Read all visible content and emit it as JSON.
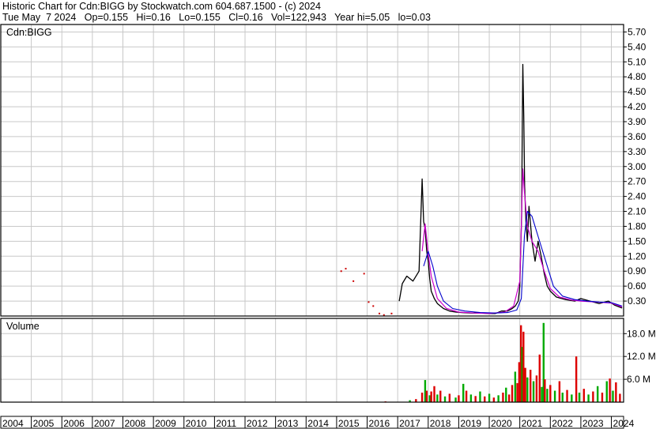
{
  "header": {
    "line1": "Historic Chart for Cdn:BIGG by Stockwatch.com 604.687.1500 - (c) 2024",
    "line2": "Tue May  7 2024   Op=0.155   Hi=0.16   Lo=0.155   Cl=0.16   Vol=122,943   Year hi=5.05   lo=0.03"
  },
  "colors": {
    "background": "#ffffff",
    "grid": "#c8c8c8",
    "price": "#000000",
    "ma_short": "#cc00cc",
    "ma_long": "#0000cc",
    "volume_up": "#00aa00",
    "volume_down": "#dd0000",
    "early_price": "#cc0000"
  },
  "chart_data": [
    {
      "type": "line",
      "panel_label": "Cdn:BIGG",
      "ylim": [
        0,
        5.85
      ],
      "y_ticks": [
        "5.70",
        "5.40",
        "5.10",
        "4.80",
        "4.50",
        "4.20",
        "3.90",
        "3.60",
        "3.30",
        "3.00",
        "2.70",
        "2.40",
        "2.10",
        "1.80",
        "1.50",
        "1.20",
        "0.90",
        "0.60",
        "0.30"
      ],
      "x_ticks": [
        "2004",
        "2005",
        "2006",
        "2007",
        "2008",
        "2009",
        "2010",
        "2011",
        "2012",
        "2013",
        "2014",
        "2015",
        "2016",
        "2017",
        "2018",
        "2019",
        "2020",
        "2021",
        "2022",
        "2023",
        "2024"
      ],
      "grid": true,
      "series": [
        {
          "role": "price",
          "x": [
            2017.05,
            2017.15,
            2017.3,
            2017.5,
            2017.7,
            2017.8,
            2017.85,
            2017.9,
            2017.95,
            2018.0,
            2018.05,
            2018.1,
            2018.2,
            2018.3,
            2018.5,
            2018.7,
            2018.9,
            2019.1,
            2019.4,
            2019.7,
            2020.0,
            2020.2,
            2020.4,
            2020.6,
            2020.75,
            2020.85,
            2020.95,
            2021.0,
            2021.03,
            2021.06,
            2021.08,
            2021.1,
            2021.13,
            2021.16,
            2021.2,
            2021.25,
            2021.3,
            2021.4,
            2021.5,
            2021.6,
            2021.7,
            2021.8,
            2021.9,
            2022.0,
            2022.2,
            2022.5,
            2022.8,
            2023.0,
            2023.3,
            2023.6,
            2023.9,
            2024.1,
            2024.35
          ],
          "values": [
            0.3,
            0.65,
            0.8,
            0.7,
            0.9,
            2.75,
            1.9,
            1.75,
            1.3,
            1.1,
            0.75,
            0.5,
            0.35,
            0.25,
            0.15,
            0.1,
            0.08,
            0.07,
            0.06,
            0.06,
            0.05,
            0.05,
            0.1,
            0.1,
            0.15,
            0.2,
            0.3,
            0.6,
            1.3,
            2.0,
            3.8,
            5.05,
            4.0,
            2.6,
            1.9,
            1.5,
            2.2,
            1.5,
            1.1,
            1.5,
            1.2,
            0.85,
            0.6,
            0.5,
            0.38,
            0.33,
            0.3,
            0.35,
            0.3,
            0.25,
            0.3,
            0.22,
            0.16
          ]
        },
        {
          "role": "moving-average-short",
          "x": [
            2017.8,
            2017.9,
            2018.0,
            2018.1,
            2018.3,
            2018.6,
            2019.0,
            2019.5,
            2020.0,
            2020.5,
            2020.8,
            2021.0,
            2021.05,
            2021.1,
            2021.15,
            2021.25,
            2021.4,
            2021.6,
            2021.8,
            2022.0,
            2022.3,
            2022.7,
            2023.0,
            2023.5,
            2024.0,
            2024.35
          ],
          "values": [
            1.3,
            1.85,
            1.25,
            0.8,
            0.35,
            0.15,
            0.08,
            0.06,
            0.05,
            0.08,
            0.2,
            0.7,
            1.8,
            2.95,
            2.5,
            1.8,
            1.5,
            1.3,
            0.9,
            0.55,
            0.38,
            0.32,
            0.3,
            0.28,
            0.26,
            0.18
          ]
        },
        {
          "role": "moving-average-long",
          "x": [
            2017.85,
            2018.0,
            2018.15,
            2018.3,
            2018.5,
            2018.8,
            2019.2,
            2019.7,
            2020.2,
            2020.6,
            2020.9,
            2021.05,
            2021.15,
            2021.25,
            2021.4,
            2021.6,
            2021.85,
            2022.1,
            2022.4,
            2022.8,
            2023.2,
            2023.6,
            2024.0,
            2024.35
          ],
          "values": [
            1.0,
            1.3,
            1.0,
            0.6,
            0.3,
            0.15,
            0.1,
            0.07,
            0.06,
            0.07,
            0.12,
            0.35,
            1.6,
            2.1,
            2.0,
            1.6,
            1.1,
            0.6,
            0.4,
            0.33,
            0.3,
            0.28,
            0.27,
            0.2
          ]
        },
        {
          "role": "early-sparse-trades",
          "x": [
            2015.15,
            2015.3,
            2015.55,
            2015.9,
            2016.05,
            2016.2,
            2016.4,
            2016.55,
            2016.8
          ],
          "values": [
            0.9,
            0.95,
            0.7,
            0.85,
            0.28,
            0.2,
            0.05,
            0.02,
            0.05
          ]
        }
      ]
    },
    {
      "type": "bar",
      "panel_label": "Volume",
      "ylim": [
        0,
        22
      ],
      "y_ticks": [
        "18.0 M",
        "12.0 M",
        "6.0 M"
      ],
      "bars": [
        {
          "x": 2016.6,
          "v": 0.2,
          "up": false
        },
        {
          "x": 2017.4,
          "v": 0.5,
          "up": true
        },
        {
          "x": 2017.6,
          "v": 0.8,
          "up": false
        },
        {
          "x": 2017.8,
          "v": 2.5,
          "up": false
        },
        {
          "x": 2017.9,
          "v": 5.8,
          "up": true
        },
        {
          "x": 2017.95,
          "v": 3.0,
          "up": false
        },
        {
          "x": 2018.05,
          "v": 1.8,
          "up": true
        },
        {
          "x": 2018.1,
          "v": 2.8,
          "up": false
        },
        {
          "x": 2018.2,
          "v": 4.2,
          "up": false
        },
        {
          "x": 2018.3,
          "v": 2.0,
          "up": true
        },
        {
          "x": 2018.4,
          "v": 3.0,
          "up": false
        },
        {
          "x": 2018.55,
          "v": 1.5,
          "up": true
        },
        {
          "x": 2018.7,
          "v": 2.2,
          "up": false
        },
        {
          "x": 2018.9,
          "v": 1.2,
          "up": true
        },
        {
          "x": 2019.0,
          "v": 1.8,
          "up": false
        },
        {
          "x": 2019.15,
          "v": 4.8,
          "up": true
        },
        {
          "x": 2019.25,
          "v": 3.0,
          "up": false
        },
        {
          "x": 2019.4,
          "v": 2.0,
          "up": true
        },
        {
          "x": 2019.55,
          "v": 1.6,
          "up": false
        },
        {
          "x": 2019.7,
          "v": 2.8,
          "up": true
        },
        {
          "x": 2019.85,
          "v": 1.5,
          "up": false
        },
        {
          "x": 2020.0,
          "v": 2.2,
          "up": true
        },
        {
          "x": 2020.15,
          "v": 1.2,
          "up": false
        },
        {
          "x": 2020.3,
          "v": 1.8,
          "up": true
        },
        {
          "x": 2020.45,
          "v": 2.5,
          "up": false
        },
        {
          "x": 2020.55,
          "v": 3.8,
          "up": true
        },
        {
          "x": 2020.65,
          "v": 2.0,
          "up": false
        },
        {
          "x": 2020.75,
          "v": 4.5,
          "up": false
        },
        {
          "x": 2020.85,
          "v": 8.0,
          "up": true
        },
        {
          "x": 2020.92,
          "v": 5.0,
          "up": false
        },
        {
          "x": 2020.98,
          "v": 10.5,
          "up": false
        },
        {
          "x": 2021.04,
          "v": 20.2,
          "up": false
        },
        {
          "x": 2021.08,
          "v": 14.5,
          "up": true
        },
        {
          "x": 2021.12,
          "v": 18.5,
          "up": false
        },
        {
          "x": 2021.18,
          "v": 9.0,
          "up": false
        },
        {
          "x": 2021.25,
          "v": 6.5,
          "up": true
        },
        {
          "x": 2021.35,
          "v": 8.5,
          "up": false
        },
        {
          "x": 2021.45,
          "v": 5.5,
          "up": true
        },
        {
          "x": 2021.55,
          "v": 7.0,
          "up": false
        },
        {
          "x": 2021.65,
          "v": 12.5,
          "up": false
        },
        {
          "x": 2021.72,
          "v": 4.0,
          "up": true
        },
        {
          "x": 2021.78,
          "v": 20.8,
          "up": true
        },
        {
          "x": 2021.82,
          "v": 6.0,
          "up": false
        },
        {
          "x": 2021.9,
          "v": 3.5,
          "up": true
        },
        {
          "x": 2022.0,
          "v": 4.5,
          "up": false
        },
        {
          "x": 2022.15,
          "v": 3.0,
          "up": true
        },
        {
          "x": 2022.3,
          "v": 5.5,
          "up": false
        },
        {
          "x": 2022.4,
          "v": 2.5,
          "up": true
        },
        {
          "x": 2022.55,
          "v": 3.2,
          "up": false
        },
        {
          "x": 2022.7,
          "v": 2.0,
          "up": true
        },
        {
          "x": 2022.85,
          "v": 12.0,
          "up": false
        },
        {
          "x": 2022.95,
          "v": 2.5,
          "up": true
        },
        {
          "x": 2023.1,
          "v": 3.5,
          "up": false
        },
        {
          "x": 2023.25,
          "v": 2.0,
          "up": true
        },
        {
          "x": 2023.4,
          "v": 2.8,
          "up": false
        },
        {
          "x": 2023.55,
          "v": 4.2,
          "up": true
        },
        {
          "x": 2023.7,
          "v": 2.5,
          "up": false
        },
        {
          "x": 2023.85,
          "v": 5.5,
          "up": true
        },
        {
          "x": 2023.95,
          "v": 6.2,
          "up": false
        },
        {
          "x": 2024.05,
          "v": 3.0,
          "up": true
        },
        {
          "x": 2024.15,
          "v": 5.2,
          "up": false
        },
        {
          "x": 2024.28,
          "v": 2.2,
          "up": false
        }
      ]
    }
  ]
}
